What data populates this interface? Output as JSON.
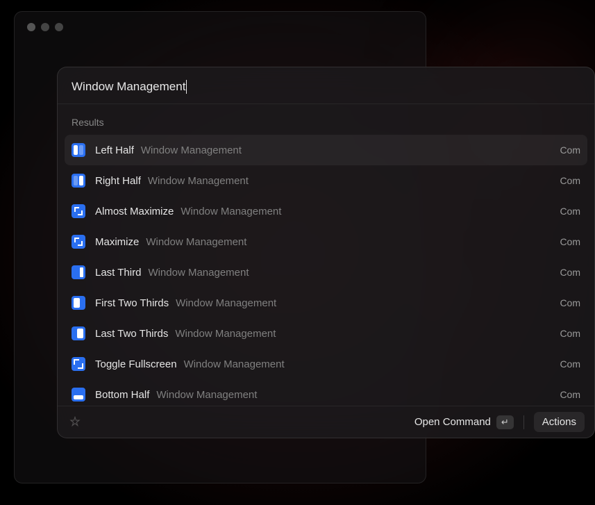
{
  "search": {
    "value": "Window Management"
  },
  "results": {
    "header": "Results",
    "items": [
      {
        "title": "Left Half",
        "subtitle": "Window Management",
        "trail": "Com",
        "icon": "left-half",
        "selected": true
      },
      {
        "title": "Right Half",
        "subtitle": "Window Management",
        "trail": "Com",
        "icon": "right-half",
        "selected": false
      },
      {
        "title": "Almost Maximize",
        "subtitle": "Window Management",
        "trail": "Com",
        "icon": "maximize",
        "selected": false
      },
      {
        "title": "Maximize",
        "subtitle": "Window Management",
        "trail": "Com",
        "icon": "maximize",
        "selected": false
      },
      {
        "title": "Last Third",
        "subtitle": "Window Management",
        "trail": "Com",
        "icon": "third",
        "selected": false
      },
      {
        "title": "First Two Thirds",
        "subtitle": "Window Management",
        "trail": "Com",
        "icon": "twothirds-first",
        "selected": false
      },
      {
        "title": "Last Two Thirds",
        "subtitle": "Window Management",
        "trail": "Com",
        "icon": "twothirds-last",
        "selected": false
      },
      {
        "title": "Toggle Fullscreen",
        "subtitle": "Window Management",
        "trail": "Com",
        "icon": "fullscreen",
        "selected": false
      },
      {
        "title": "Bottom Half",
        "subtitle": "Window Management",
        "trail": "Com",
        "icon": "bottom",
        "selected": false
      }
    ]
  },
  "footer": {
    "open_command": "Open Command",
    "open_key": "↵",
    "actions": "Actions"
  }
}
